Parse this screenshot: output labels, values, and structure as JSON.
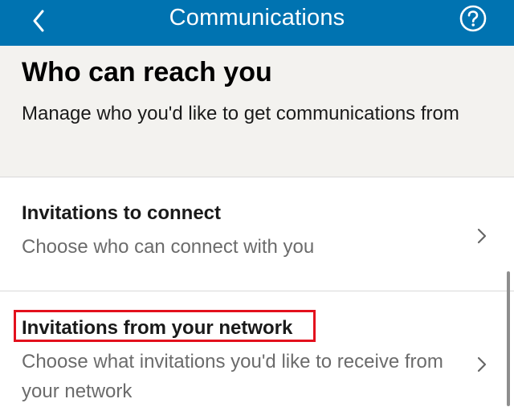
{
  "header": {
    "title": "Communications"
  },
  "section": {
    "title": "Who can reach you",
    "description": "Manage who you'd like to get communications from"
  },
  "rows": [
    {
      "title": "Invitations to connect",
      "subtitle": "Choose who can connect with you"
    },
    {
      "title": "Invitations from your network",
      "subtitle": "Choose what invitations you'd like to receive from your network"
    }
  ],
  "colors": {
    "brand": "#0073b1",
    "highlight": "#e3101d"
  },
  "icons": {
    "back": "chevron-left-icon",
    "help": "help-circle-icon",
    "row_chevron": "chevron-right-icon"
  }
}
